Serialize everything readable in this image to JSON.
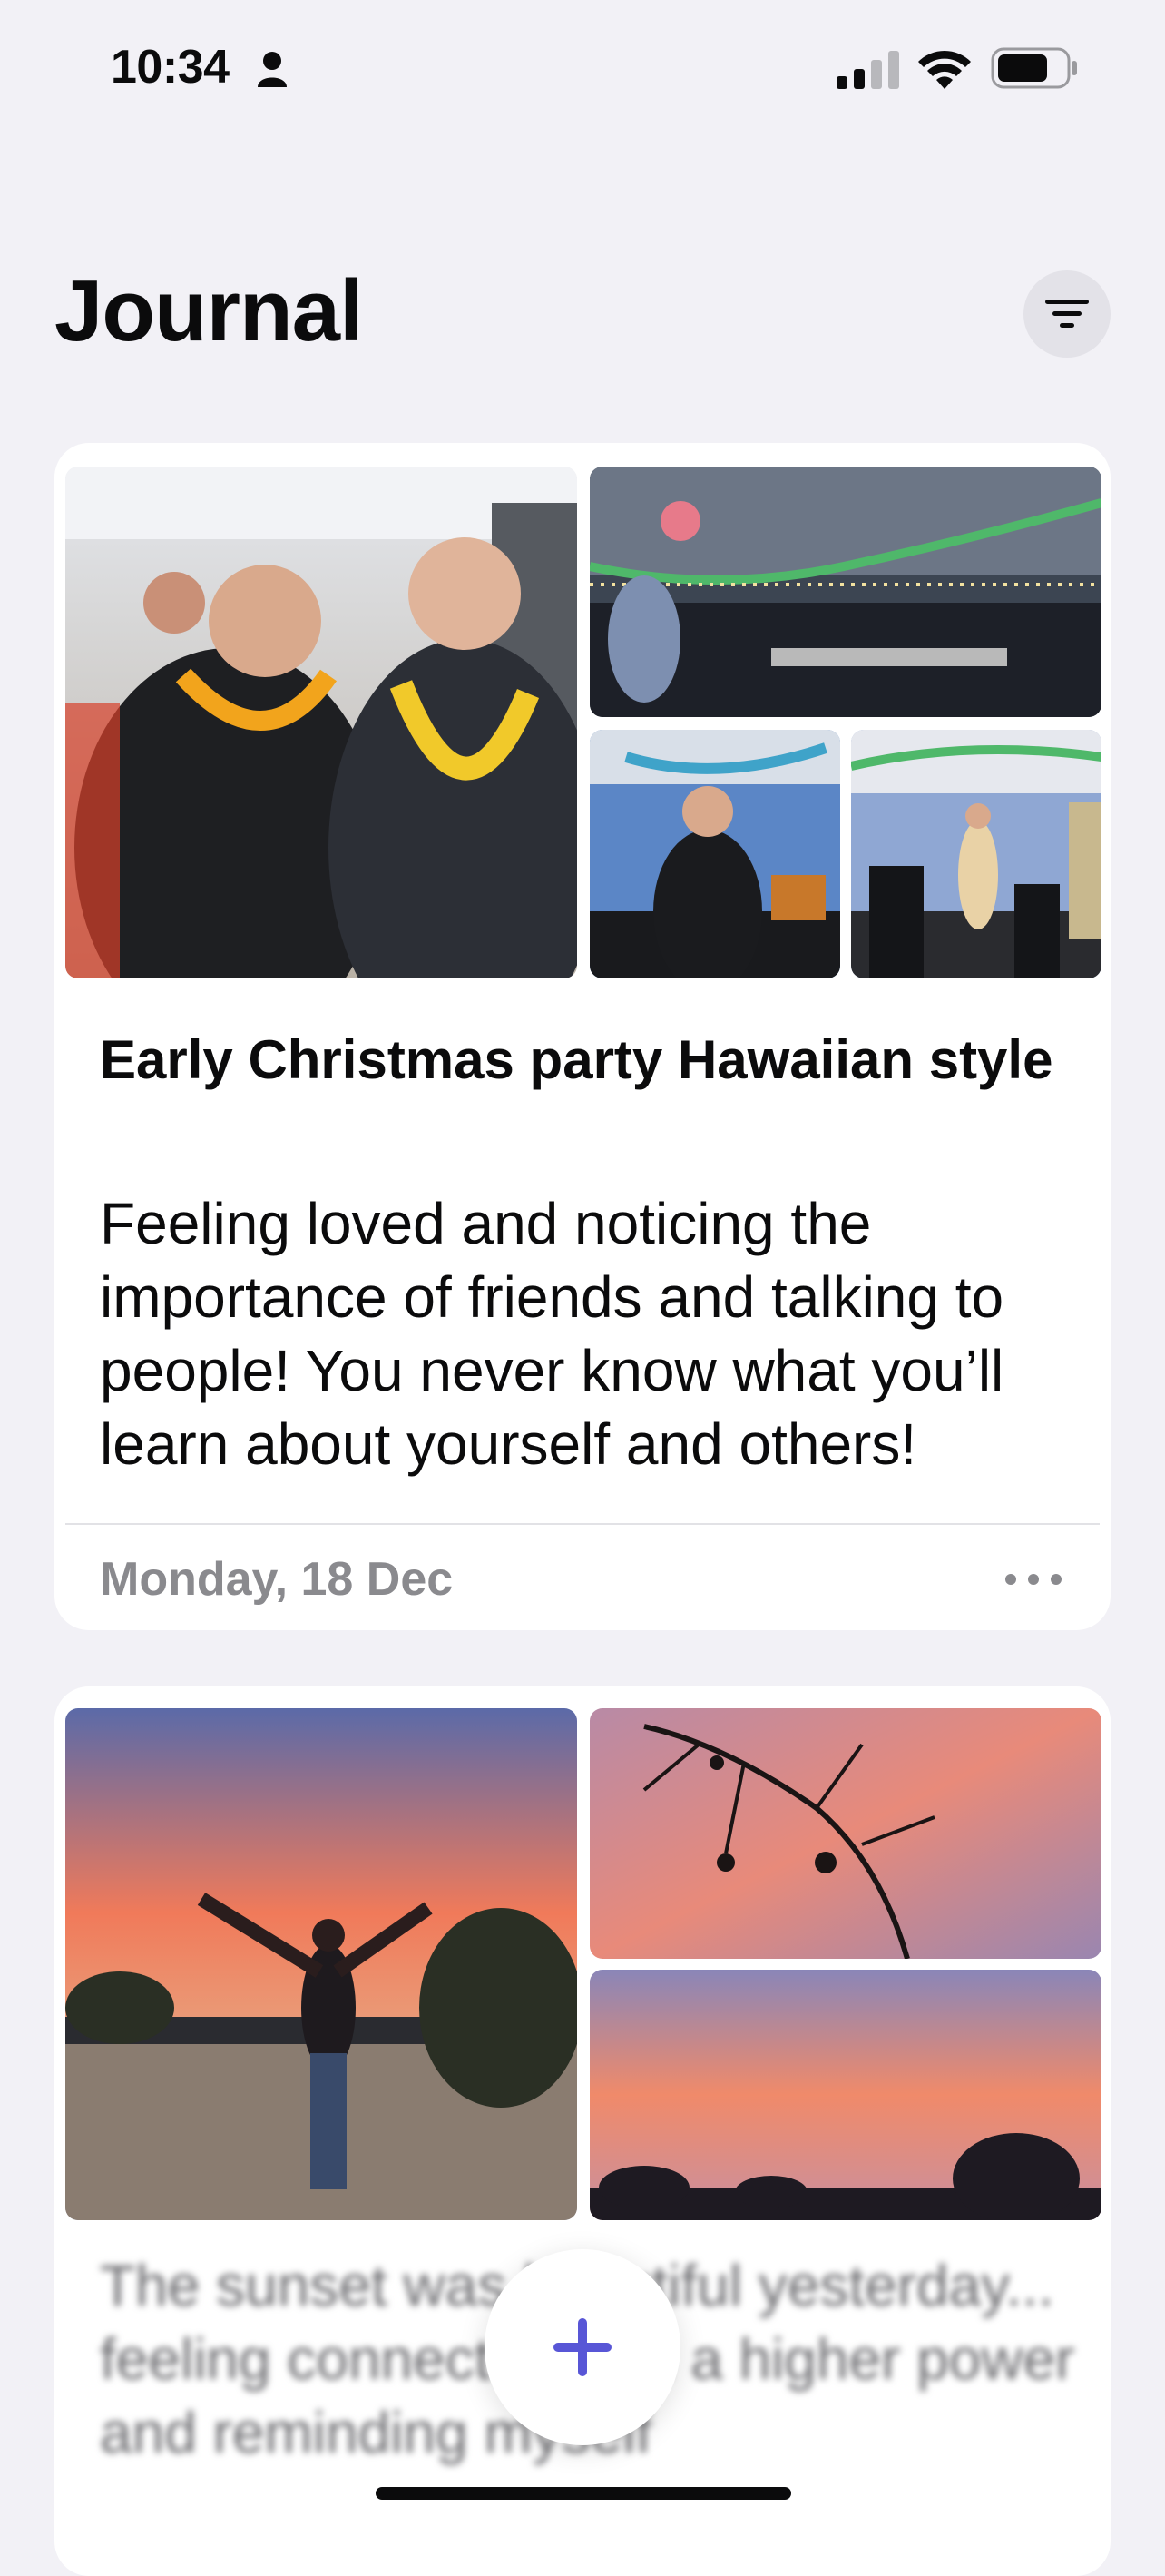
{
  "status_bar": {
    "time": "10:34",
    "battery_level": 0.75,
    "signal_bars": 2,
    "signal_total": 4
  },
  "header": {
    "title": "Journal",
    "filter_icon": "filter-lines-icon"
  },
  "entries": [
    {
      "title": "Early Christmas party Hawaiian style",
      "body": "Feeling loved and noticing the importance of friends and talking to people! You never know what you’ll learn about yourself and others!",
      "date": "Monday, 18 Dec",
      "more_icon": "ellipsis-icon",
      "photos": [
        "party-selfie-photo",
        "party-room-photo",
        "party-speech-photo",
        "party-crowd-photo"
      ]
    },
    {
      "body": "The sunset was beautiful yesterday... feeling connected with a higher power and reminding myself",
      "photos": [
        "sunset-person-photo",
        "sunset-branches-photo",
        "sunset-trees-photo"
      ]
    }
  ],
  "fab": {
    "icon": "plus-icon"
  },
  "colors": {
    "accent": "#5856d6",
    "background": "#f2f1f6",
    "card": "#ffffff",
    "secondary_text": "#8a8a8e"
  }
}
